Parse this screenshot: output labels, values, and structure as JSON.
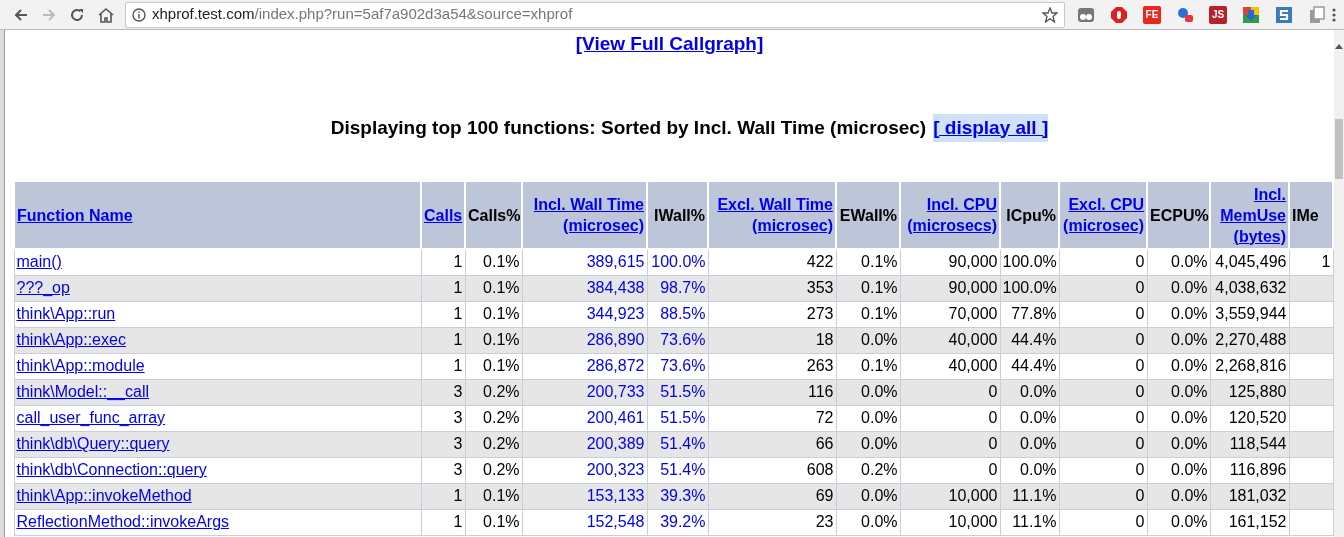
{
  "browser": {
    "url_host": "xhprof.test.com",
    "url_path": "/index.php?run=5af7a902d3a54&source=xhprof",
    "extensions": [
      {
        "kind": "eyes",
        "color": "#777777"
      },
      {
        "kind": "hand",
        "color": "#e02020"
      },
      {
        "kind": "text",
        "label": "FE",
        "color": "#e8281e"
      },
      {
        "kind": "shapes",
        "color": "#2a6fd6"
      },
      {
        "kind": "text",
        "label": "JS",
        "color": "#b5222a"
      },
      {
        "kind": "download",
        "color": "#2e9e44"
      },
      {
        "kind": "letter-s",
        "color": "#3a7bbf"
      },
      {
        "kind": "copy",
        "color": "#9a9a9a"
      }
    ]
  },
  "page": {
    "callgraph_link": "[View Full Callgraph]",
    "heading": "Displaying top 100 functions: Sorted by Incl. Wall Time (microsec)",
    "display_all": {
      "label": "[ display all ]",
      "highlighted": true
    }
  },
  "table": {
    "columns": [
      {
        "lines": [
          "Function Name"
        ],
        "link": true
      },
      {
        "lines": [
          "Calls"
        ],
        "link": true,
        "highlight": false
      },
      {
        "lines": [
          "Calls%"
        ],
        "link": false,
        "highlight": false
      },
      {
        "lines": [
          "Incl. Wall Time",
          "(microsec)"
        ],
        "link": true,
        "highlight": true
      },
      {
        "lines": [
          "IWall%"
        ],
        "link": false,
        "highlight": true
      },
      {
        "lines": [
          "Excl. Wall Time",
          "(microsec)"
        ],
        "link": true,
        "highlight": false
      },
      {
        "lines": [
          "EWall%"
        ],
        "link": false,
        "highlight": false
      },
      {
        "lines": [
          "Incl. CPU",
          "(microsecs)"
        ],
        "link": true,
        "highlight": false
      },
      {
        "lines": [
          "ICpu%"
        ],
        "link": false,
        "highlight": false
      },
      {
        "lines": [
          "Excl. CPU",
          "(microsec)"
        ],
        "link": true,
        "highlight": false
      },
      {
        "lines": [
          "ECPU%"
        ],
        "link": false,
        "highlight": false
      },
      {
        "lines": [
          "Incl.",
          "MemUse",
          "(bytes)"
        ],
        "link": true,
        "highlight": false
      },
      {
        "lines": [
          "IMe"
        ],
        "link": false,
        "highlight": false
      }
    ],
    "rows": [
      [
        "main()",
        "1",
        "0.1%",
        "389,615",
        "100.0%",
        "422",
        "0.1%",
        "90,000",
        "100.0%",
        "0",
        "0.0%",
        "4,045,496",
        "1"
      ],
      [
        "???_op",
        "1",
        "0.1%",
        "384,438",
        "98.7%",
        "353",
        "0.1%",
        "90,000",
        "100.0%",
        "0",
        "0.0%",
        "4,038,632"
      ],
      [
        "think\\App::run",
        "1",
        "0.1%",
        "344,923",
        "88.5%",
        "273",
        "0.1%",
        "70,000",
        "77.8%",
        "0",
        "0.0%",
        "3,559,944"
      ],
      [
        "think\\App::exec",
        "1",
        "0.1%",
        "286,890",
        "73.6%",
        "18",
        "0.0%",
        "40,000",
        "44.4%",
        "0",
        "0.0%",
        "2,270,488"
      ],
      [
        "think\\App::module",
        "1",
        "0.1%",
        "286,872",
        "73.6%",
        "263",
        "0.1%",
        "40,000",
        "44.4%",
        "0",
        "0.0%",
        "2,268,816"
      ],
      [
        "think\\Model::__call",
        "3",
        "0.2%",
        "200,733",
        "51.5%",
        "116",
        "0.0%",
        "0",
        "0.0%",
        "0",
        "0.0%",
        "125,880"
      ],
      [
        "call_user_func_array",
        "3",
        "0.2%",
        "200,461",
        "51.5%",
        "72",
        "0.0%",
        "0",
        "0.0%",
        "0",
        "0.0%",
        "120,520"
      ],
      [
        "think\\db\\Query::query",
        "3",
        "0.2%",
        "200,389",
        "51.4%",
        "66",
        "0.0%",
        "0",
        "0.0%",
        "0",
        "0.0%",
        "118,544"
      ],
      [
        "think\\db\\Connection::query",
        "3",
        "0.2%",
        "200,323",
        "51.4%",
        "608",
        "0.2%",
        "0",
        "0.0%",
        "0",
        "0.0%",
        "116,896"
      ],
      [
        "think\\App::invokeMethod",
        "1",
        "0.1%",
        "153,133",
        "39.3%",
        "69",
        "0.0%",
        "10,000",
        "11.1%",
        "0",
        "0.0%",
        "181,032"
      ],
      [
        "ReflectionMethod::invokeArgs",
        "1",
        "0.1%",
        "152,548",
        "39.2%",
        "23",
        "0.0%",
        "10,000",
        "11.1%",
        "0",
        "0.0%",
        "161,152"
      ]
    ]
  }
}
